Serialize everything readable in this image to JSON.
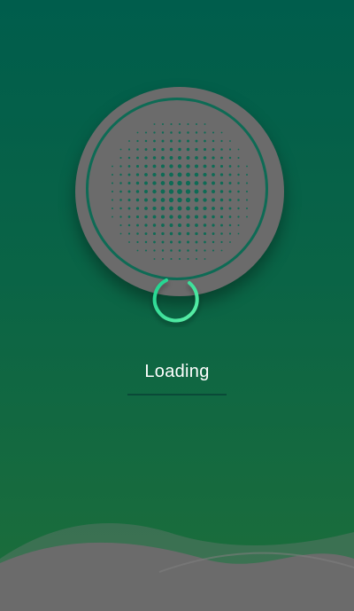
{
  "status": {
    "label": "Loading"
  },
  "icons": {
    "speaker": "speaker-grille-icon",
    "spinner": "loading-spinner-icon"
  },
  "colors": {
    "background_top": "#005d4c",
    "background_bottom": "#1d6e3a",
    "speaker_body": "#6b6b6b",
    "speaker_ring": "#0e6b55",
    "grille_dots": "#0e6b55",
    "spinner_start": "#1fd38f",
    "spinner_end": "#5ef0a8",
    "wave": "#6b6b6b"
  }
}
